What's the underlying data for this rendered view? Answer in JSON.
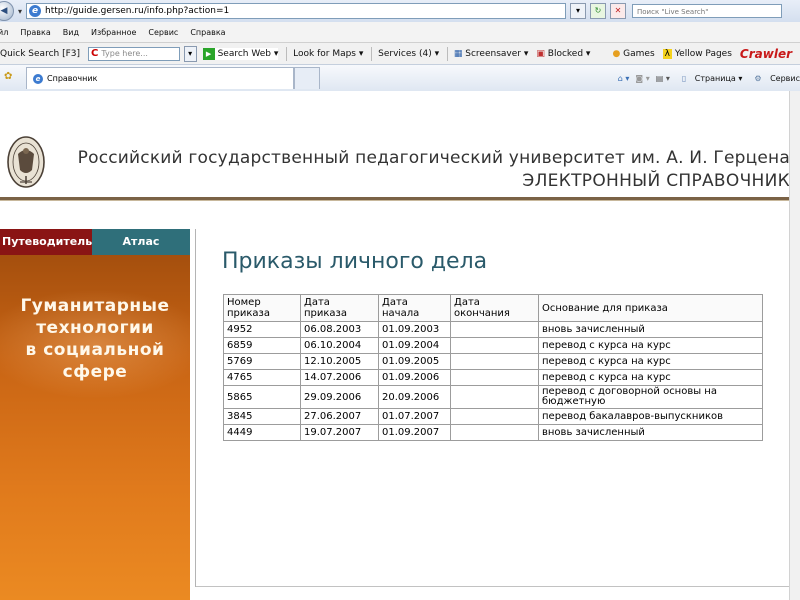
{
  "browser": {
    "url": "http://guide.gersen.ru/info.php?action=1",
    "live_search_placeholder": "Поиск \"Live Search\"",
    "menu": [
      "йл",
      "Правка",
      "Вид",
      "Избранное",
      "Сервис",
      "Справка"
    ],
    "toolbar": {
      "quick_search": "Quick Search [F3]",
      "type_here": "Type here...",
      "search_web": "Search Web",
      "look_for_maps": "Look for Maps",
      "services": "Services (4)",
      "screensaver": "Screensaver",
      "blocked": "Blocked",
      "games": "Games",
      "yellow_pages": "Yellow Pages",
      "crawler_brand": "Crawler"
    },
    "tab_title": "Справочник",
    "cmd": {
      "page": "Страница",
      "service": "Сервис"
    }
  },
  "header": {
    "university": "Российский государственный педагогический университет им. А. И. Герцена",
    "reference": "ЭЛЕКТРОННЫЙ СПРАВОЧНИК"
  },
  "sidebar": {
    "tabs": [
      "Путеводитель",
      "Атлас"
    ],
    "caption_lines": [
      "Гуманитарные",
      "технологии",
      "в социальной",
      "сфере"
    ]
  },
  "main": {
    "title": "Приказы личного дела",
    "table": {
      "headers": [
        [
          "Номер",
          "приказа"
        ],
        [
          "Дата",
          "приказа"
        ],
        [
          "Дата",
          "начала"
        ],
        [
          "Дата",
          "окончания"
        ],
        [
          "Основание для приказа",
          ""
        ]
      ],
      "rows": [
        [
          "4952",
          "06.08.2003",
          "01.09.2003",
          "",
          "вновь зачисленный"
        ],
        [
          "6859",
          "06.10.2004",
          "01.09.2004",
          "",
          "перевод с курса на курс"
        ],
        [
          "5769",
          "12.10.2005",
          "01.09.2005",
          "",
          "перевод с курса на курс"
        ],
        [
          "4765",
          "14.07.2006",
          "01.09.2006",
          "",
          "перевод с курса на курс"
        ],
        [
          "5865",
          "29.09.2006",
          "20.09.2006",
          "",
          "перевод с договорной основы на бюджетную"
        ],
        [
          "3845",
          "27.06.2007",
          "01.07.2007",
          "",
          "перевод бакалавров-выпускников"
        ],
        [
          "4449",
          "19.07.2007",
          "01.09.2007",
          "",
          "вновь зачисленный"
        ]
      ]
    }
  },
  "colors": {
    "heading": "#2a5a6a",
    "tab_guide": "#8a1414",
    "tab_atlas": "#2f6f7a",
    "sidebar_orange": "#e07a1c",
    "rule": "#7a6246"
  }
}
